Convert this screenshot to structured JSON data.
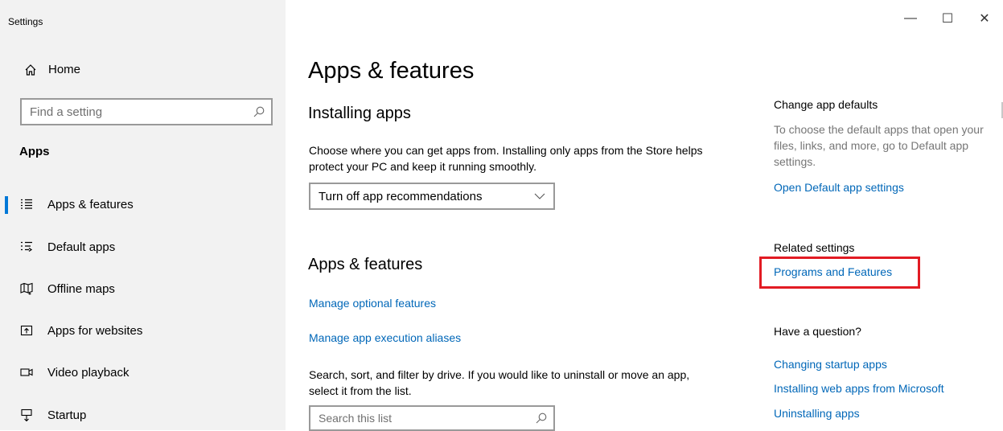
{
  "window": {
    "title": "Settings",
    "controls": {
      "minimize": "—",
      "maximize": "☐",
      "close": "✕"
    }
  },
  "sidebar": {
    "home_label": "Home",
    "search_placeholder": "Find a setting",
    "section_label": "Apps",
    "items": [
      {
        "label": "Apps & features",
        "icon": "apps-features-icon",
        "active": true
      },
      {
        "label": "Default apps",
        "icon": "default-apps-icon",
        "active": false
      },
      {
        "label": "Offline maps",
        "icon": "map-icon",
        "active": false
      },
      {
        "label": "Apps for websites",
        "icon": "apps-websites-icon",
        "active": false
      },
      {
        "label": "Video playback",
        "icon": "video-icon",
        "active": false
      },
      {
        "label": "Startup",
        "icon": "startup-icon",
        "active": false
      }
    ]
  },
  "main": {
    "title": "Apps & features",
    "installing": {
      "heading": "Installing apps",
      "description": "Choose where you can get apps from. Installing only apps from the Store helps protect your PC and keep it running smoothly.",
      "dropdown_value": "Turn off app recommendations"
    },
    "apps_features": {
      "heading": "Apps & features",
      "link_optional": "Manage optional features",
      "link_aliases": "Manage app execution aliases",
      "description": "Search, sort, and filter by drive. If you would like to uninstall or move an app, select it from the list.",
      "search_placeholder": "Search this list"
    }
  },
  "right": {
    "defaults_heading": "Change app defaults",
    "defaults_text": "To choose the default apps that open your files, links, and more, go to Default app settings.",
    "defaults_link": "Open Default app settings",
    "related_heading": "Related settings",
    "related_link": "Programs and Features",
    "question_heading": "Have a question?",
    "question_links": [
      "Changing startup apps",
      "Installing web apps from Microsoft",
      "Uninstalling apps"
    ]
  },
  "colors": {
    "accent": "#0078d7",
    "link": "#0067b8",
    "highlight": "#e21b23",
    "sidebar_bg": "#f2f2f2"
  }
}
